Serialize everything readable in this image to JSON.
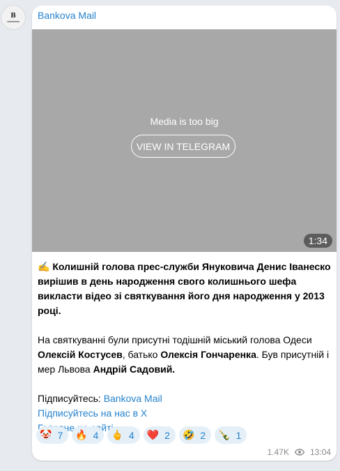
{
  "channel": {
    "name": "Bankova Mail",
    "avatar_icon": "bankova-logo-icon"
  },
  "media": {
    "message": "Media is too big",
    "button_label": "VIEW IN TELEGRAM",
    "duration": "1:34"
  },
  "post": {
    "p1": {
      "emoji": "✍️",
      "bold": "Колишній голова прес-служби Януковича Денис Іванеско вирішив в день народження свого колишнього шефа викласти відео зі святкування його дня народження у 2013 році."
    },
    "p2": {
      "t1": "На святкуванні були присутні тодішній міський голова Одеси ",
      "b1": "Олексій Костусев",
      "t2": ", батько ",
      "b2": "Олексія Гончаренка",
      "t3": ". Був присутній і мер Львова ",
      "b3": "Андрій Садовий."
    },
    "p3": {
      "subscribe_label": "Підписуйтесь: ",
      "subscribe_link": "Bankova Mail",
      "x_link": "Підписуйтесь на нас в X",
      "site_link": "Головне на сайті"
    }
  },
  "reactions": [
    {
      "emoji": "🤡",
      "count": "7"
    },
    {
      "emoji": "🔥",
      "count": "4"
    },
    {
      "emoji": "🖕",
      "count": "4"
    },
    {
      "emoji": "❤️",
      "count": "2"
    },
    {
      "emoji": "🤣",
      "count": "2"
    },
    {
      "emoji": "🍾",
      "count": "1"
    }
  ],
  "footer": {
    "views": "1.47K",
    "time": "13:04"
  },
  "colors": {
    "accent": "#2481cc",
    "background": "#e7ebf0",
    "media_placeholder": "#a8a8a8"
  }
}
